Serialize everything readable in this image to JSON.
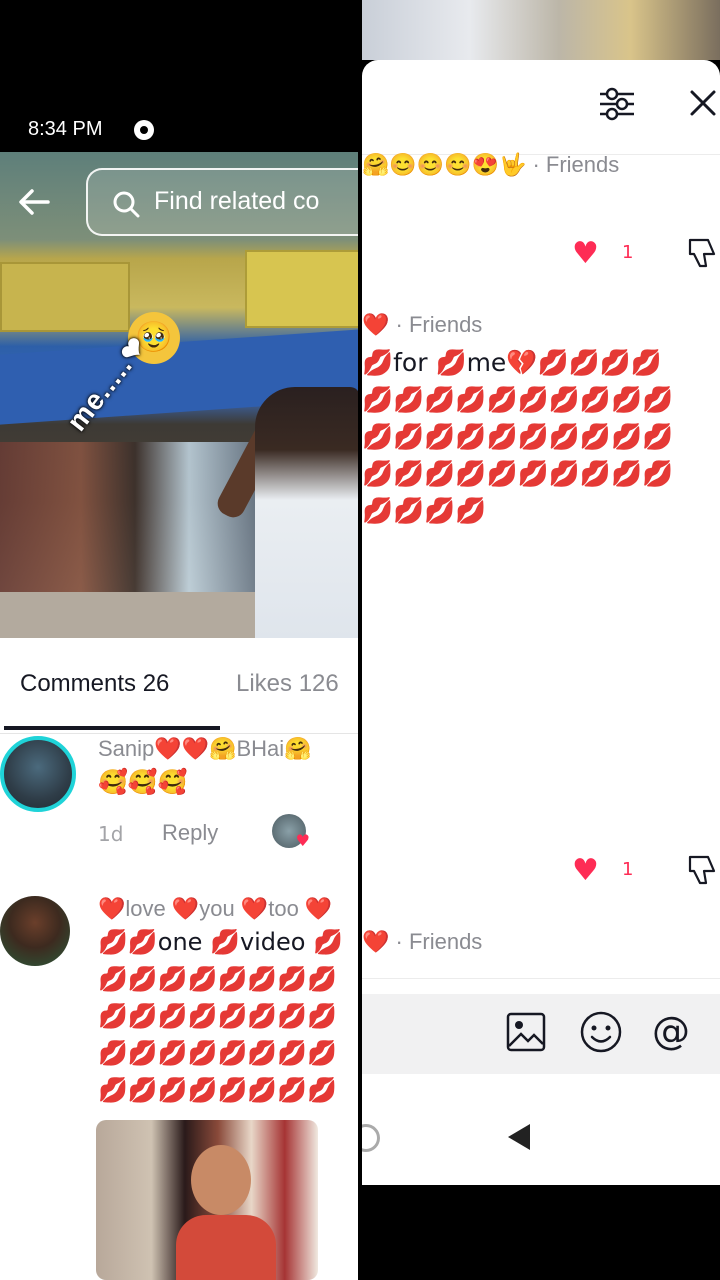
{
  "status_bar": {
    "time": "8:34 PM"
  },
  "video": {
    "search_placeholder": "Find related co",
    "overlay_text": "me.....❤",
    "sticker_emoji": "🥹"
  },
  "tabs": [
    {
      "label": "Comments 26",
      "active": true
    },
    {
      "label": "Likes 126",
      "active": false
    }
  ],
  "comments": [
    {
      "username": "Sanip❤️❤️🤗BHai🤗",
      "body": "🥰🥰🥰",
      "time": "1d",
      "reply_label": "Reply"
    },
    {
      "username": "❤️love ❤️you ❤️too ❤️",
      "body": "💋💋one 💋video 💋\n💋💋💋💋💋💋💋💋\n💋💋💋💋💋💋💋💋\n💋💋💋💋💋💋💋💋\n💋💋💋💋💋💋💋💋"
    }
  ],
  "right_panel": {
    "top_meta": "🤗😊😊😊😍🤟 · Friends",
    "like_count_1": "1",
    "reply_meta": "❤️ · Friends",
    "reply_body": "💋for 💋me💔💋💋💋💋\n💋💋💋💋💋💋💋💋💋💋\n💋💋💋💋💋💋💋💋💋💋\n💋💋💋💋💋💋💋💋💋💋\n💋💋💋💋",
    "like_count_2": "1",
    "bottom_meta": "❤️ · Friends"
  },
  "colors": {
    "accent_heart": "#fe2c55",
    "story_ring": "#1fd3d8",
    "text_primary": "#161823",
    "text_secondary": "#8a8b91"
  }
}
